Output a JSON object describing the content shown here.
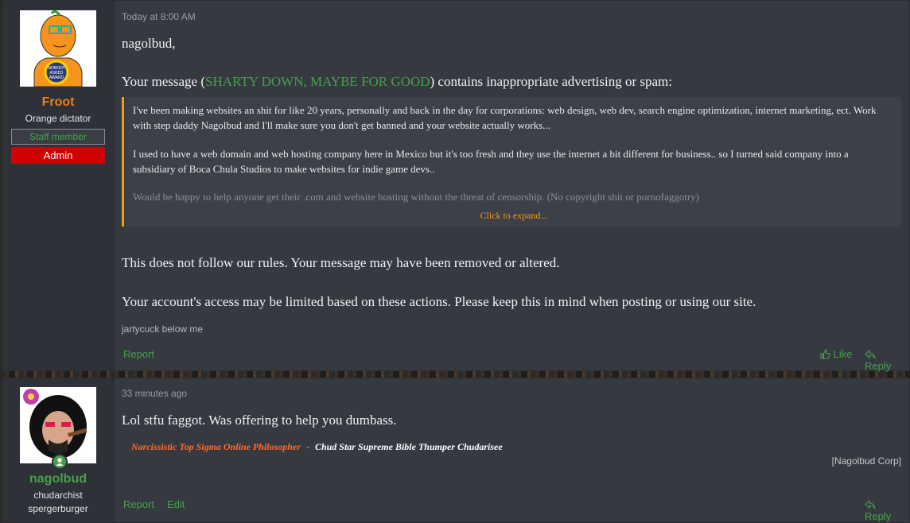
{
  "post1": {
    "username": "Froot",
    "user_title": "Orange dictator",
    "staff_badge": "Staff member",
    "admin_badge": "Admin",
    "time": "Today at 8:00 AM",
    "greeting": "nagolbud,",
    "msg_prefix": "Your message (",
    "thread_link": "SHARTY DOWN, MAYBE FOR GOOD",
    "msg_suffix": ") contains inappropriate advertising or spam:",
    "quote_p1": "I've been making websites an shit for like 20 years, personally and back in the day for corporations: web design, web dev, search engine optimization, internet marketing, ect. Work with step daddy Nagolbud and I'll make sure you don't get banned and your website actually works...",
    "quote_p2": "I used to have a web domain and web hosting company here in Mexico but it's too fresh and they use the internet a bit different for business.. so I turned said company into a subsidiary of Boca Chula Studios to make websites for indie game devs..",
    "quote_p3": "Would be happy to help anyone get their .com and website hosting without the threat of censorship. (No copyright shit or pornofaggotry)",
    "expand": "Click to expand...",
    "rules_line": "This does not follow our rules. Your message may have been removed or altered.",
    "access_line": "Your account's access may be limited based on these actions. Please keep this in mind when posting or using our site.",
    "signature": "jartycuck below me",
    "report": "Report",
    "like": "Like",
    "reply": "Reply",
    "avatar_text": [
      "NOBODY",
      "ASKED",
      "AWARD"
    ],
    "name_color": "#e8811a"
  },
  "post2": {
    "username": "nagolbud",
    "user_title_1": "chudarchist",
    "user_title_2": "spergerburger",
    "time": "33 minutes ago",
    "message": "Lol stfu faggot. Was offering to help you dumbass.",
    "sig_a": "Narcissistic Top Sigma Online Philosopher",
    "sig_sep": "-",
    "sig_b": "Chud Star Supreme Bible Thumper Chudarisee",
    "corp": "[Nagolbud Corp]",
    "report": "Report",
    "edit": "Edit",
    "reply": "Reply",
    "name_color": "#46a04a"
  }
}
